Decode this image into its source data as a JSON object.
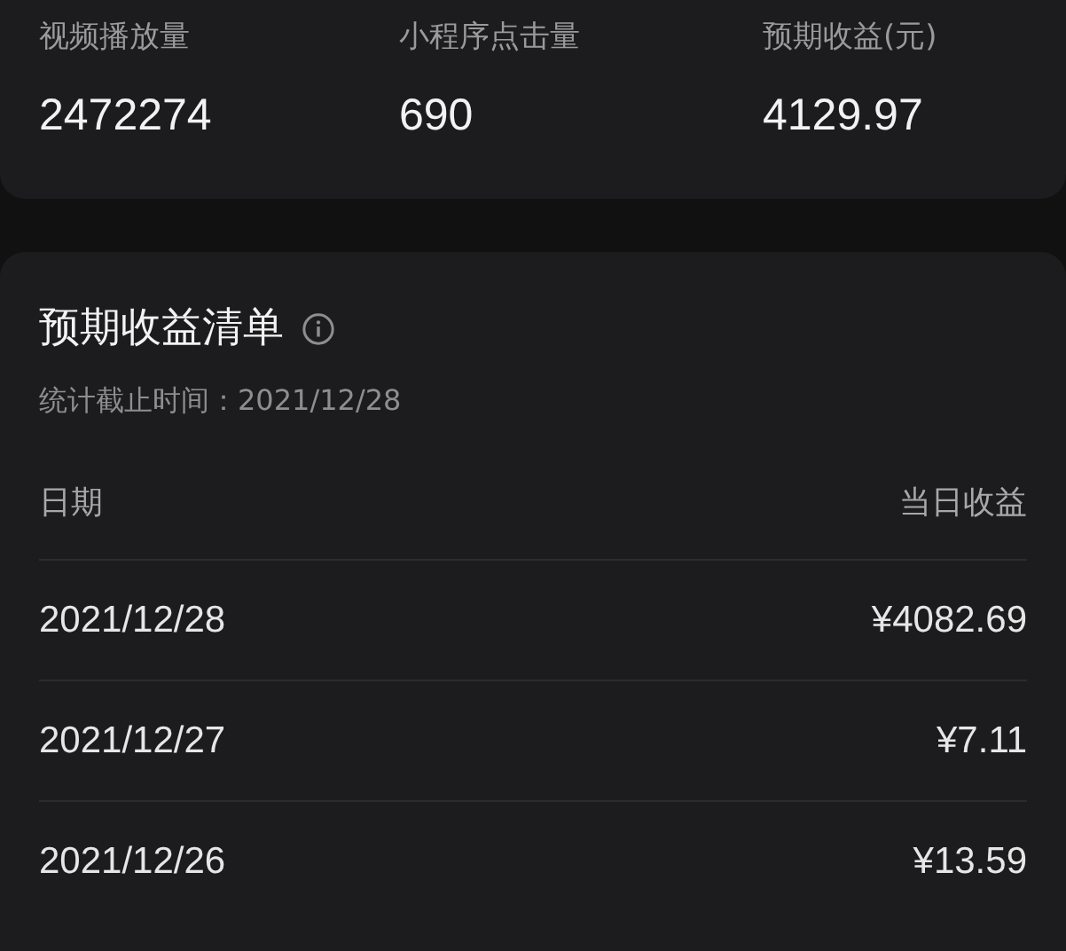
{
  "stats": [
    {
      "label": "视频播放量",
      "value": "2472274"
    },
    {
      "label": "小程序点击量",
      "value": "690"
    },
    {
      "label": "预期收益(元)",
      "value": "4129.97"
    }
  ],
  "earnings": {
    "title": "预期收益清单",
    "cutoff": "统计截止时间：2021/12/28",
    "columns": [
      "日期",
      "当日收益"
    ],
    "rows": [
      {
        "date": "2021/12/28",
        "amount": "¥4082.69"
      },
      {
        "date": "2021/12/27",
        "amount": "¥7.11"
      },
      {
        "date": "2021/12/26",
        "amount": "¥13.59"
      }
    ]
  }
}
